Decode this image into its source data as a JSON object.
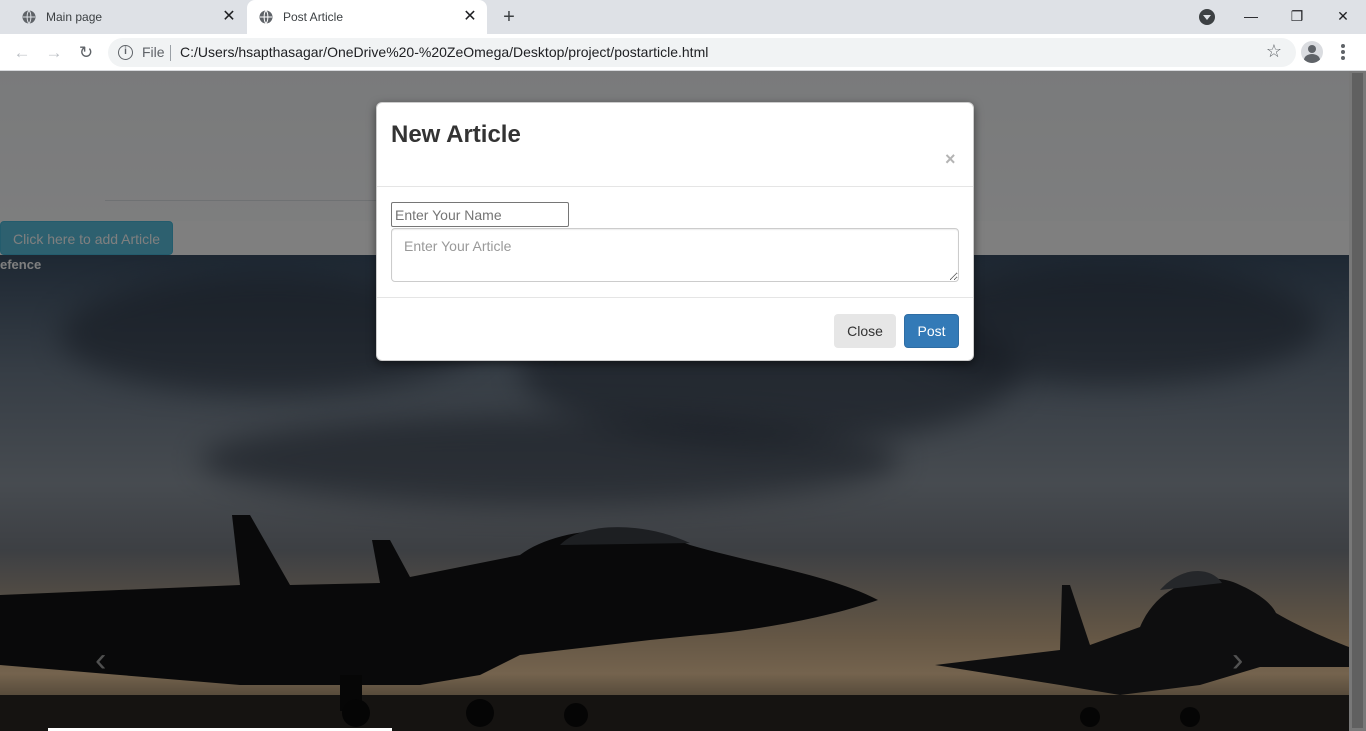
{
  "browser": {
    "tabs": [
      {
        "title": "Main page"
      },
      {
        "title": "Post Article"
      }
    ],
    "address": {
      "scheme_label": "File",
      "url": "C:/Users/hsapthasagar/OneDrive%20-%20ZeOmega/Desktop/project/postarticle.html"
    }
  },
  "page": {
    "add_article_button": "Click here to add Article",
    "logo_text": "efence"
  },
  "modal": {
    "title": "New Article",
    "close_glyph": "×",
    "name_placeholder": "Enter Your Name",
    "article_placeholder": "Enter Your Article",
    "close_button": "Close",
    "post_button": "Post"
  },
  "colors": {
    "primary": "#337ab7",
    "info": "#5bc0de",
    "default": "#e6e6e6"
  },
  "icons": {
    "tab": "globe-icon",
    "close": "close-icon",
    "new_tab": "plus-icon",
    "back": "back-arrow-icon",
    "forward": "forward-arrow-icon",
    "reload": "reload-icon",
    "info": "info-icon",
    "bookmark": "star-icon",
    "profile": "profile-icon",
    "menu": "kebab-menu-icon"
  }
}
